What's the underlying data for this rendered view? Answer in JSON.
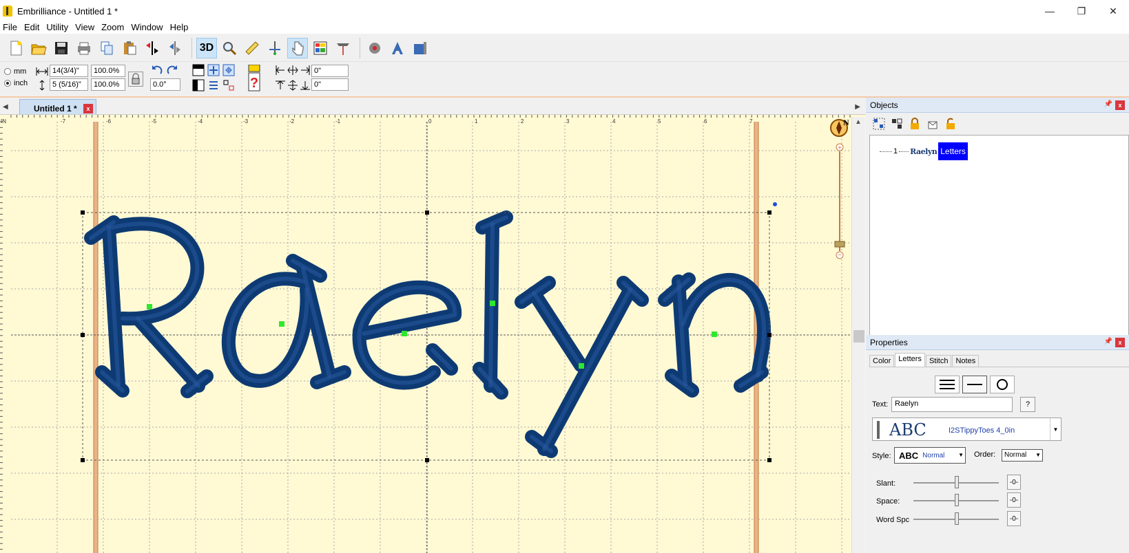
{
  "window": {
    "app_name": "Embrilliance",
    "separator": "-",
    "doc_title": "Untitled 1 *",
    "minimize": "—",
    "restore": "❐",
    "close": "✕"
  },
  "menu": [
    "File",
    "Edit",
    "Utility",
    "View",
    "Zoom",
    "Window",
    "Help"
  ],
  "toolbar": {
    "three_d_label": "3D"
  },
  "propbar": {
    "unit_mm": "mm",
    "unit_inch": "inch",
    "width": "14(3/4)\"",
    "height": "5 (5/16)\"",
    "width_pct": "100.0%",
    "height_pct": "100.0%",
    "rotation": "0.0°",
    "offset_x": "0\"",
    "offset_y": "0\""
  },
  "doctab": {
    "label": "Untitled 1 *",
    "close": "x"
  },
  "ruler": {
    "origin": "IN",
    "ticks": [
      "-7",
      "-6",
      "-5",
      "-4",
      "-3",
      "-2",
      "-1",
      "0",
      "1",
      "2",
      "3",
      "4",
      "5",
      "6",
      "7"
    ]
  },
  "canvas": {
    "design_text": "Raelyn",
    "thread_color": "#0d3a73"
  },
  "compass": {
    "north": "N",
    "zoom_in": "+",
    "zoom_out": "−"
  },
  "objects_panel": {
    "title": "Objects",
    "pin": "📌",
    "close": "x",
    "tree": {
      "number": "1",
      "thumb": "Raelyn",
      "type": "Letters"
    }
  },
  "properties_panel": {
    "title": "Properties",
    "pin": "📌",
    "close": "x",
    "tabs": [
      "Color",
      "Letters",
      "Stitch",
      "Notes"
    ],
    "active_tab": "Letters",
    "text_label": "Text:",
    "text_value": "Raelyn",
    "help": "?",
    "font_sample": "ABC",
    "font_name": "I2STippyToes 4_0in",
    "style_label": "Style:",
    "style_sample": "ABC",
    "style_value": "Normal",
    "order_label": "Order:",
    "order_value": "Normal",
    "sliders": [
      {
        "label": "Slant:",
        "value": "-0-"
      },
      {
        "label": "Space:",
        "value": "-0-"
      },
      {
        "label": "Word Spc",
        "value": "-0-"
      }
    ]
  }
}
